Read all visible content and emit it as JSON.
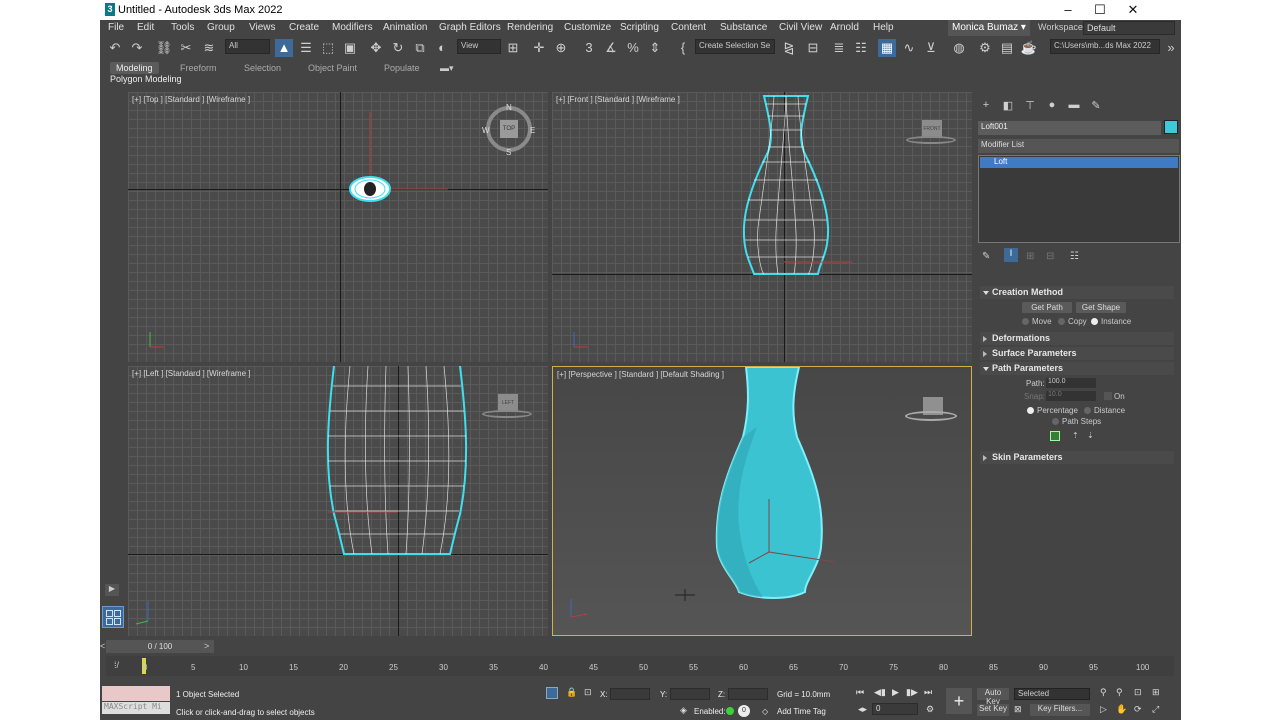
{
  "window": {
    "title": "Untitled - Autodesk 3ds Max 2022",
    "minimize": "–",
    "maximize": "☐",
    "close": "✕"
  },
  "menu": [
    "File",
    "Edit",
    "Tools",
    "Group",
    "Views",
    "Create",
    "Modifiers",
    "Animation",
    "Graph Editors",
    "Rendering",
    "Customize",
    "Scripting",
    "Content",
    "Substance",
    "Civil View",
    "Arnold",
    "Help"
  ],
  "user": {
    "name": "Monica Bumaz ▾",
    "workspaces_label": "Workspaces:",
    "workspace": "Default"
  },
  "toolbar": {
    "filter": "All",
    "refcoord": "View",
    "selection_set": "Create Selection Se",
    "project_path": "C:\\Users\\mb...ds Max 2022"
  },
  "ribbon": {
    "tabs": [
      "Modeling",
      "Freeform",
      "Selection",
      "Object Paint",
      "Populate"
    ],
    "sub": "Polygon Modeling"
  },
  "viewports": {
    "top": "[+] [Top ] [Standard ] [Wireframe ]",
    "front": "[+] [Front ] [Standard ] [Wireframe ]",
    "left": "[+] [Left ] [Standard ] [Wireframe ]",
    "perspective": "[+] [Perspective ] [Standard ] [Default Shading ]"
  },
  "viewcube": {
    "top_label": "TOP",
    "front_label": "FRONT",
    "left_label": "LEFT",
    "compass": [
      "N",
      "S",
      "E",
      "W"
    ]
  },
  "command_panel": {
    "object_name": "Loft001",
    "modifier_list": "Modifier List",
    "stack_item": "Loft",
    "object_color": "#3ec8d8",
    "creation_method": {
      "title": "Creation Method",
      "get_path": "Get Path",
      "get_shape": "Get Shape",
      "move": "Move",
      "copy": "Copy",
      "instance": "Instance"
    },
    "deformations": "Deformations",
    "surface_parameters": "Surface Parameters",
    "path_parameters": {
      "title": "Path Parameters",
      "path_label": "Path:",
      "path_value": "100.0",
      "snap_label": "Snap:",
      "snap_value": "10.0",
      "on": "On",
      "percentage": "Percentage",
      "distance": "Distance",
      "path_steps": "Path Steps"
    },
    "skin_parameters": "Skin Parameters"
  },
  "timeline": {
    "frame": "0 / 100",
    "ticks": [
      "0",
      "5",
      "10",
      "15",
      "20",
      "25",
      "30",
      "35",
      "40",
      "45",
      "50",
      "55",
      "60",
      "65",
      "70",
      "75",
      "80",
      "85",
      "90",
      "95",
      "100"
    ]
  },
  "status": {
    "selected": "1 Object Selected",
    "prompt": "Click or click-and-drag to select objects",
    "maxscript": "MAXScript Mi",
    "x_label": "X:",
    "y_label": "Y:",
    "z_label": "Z:",
    "grid": "Grid = 10.0mm",
    "enabled_label": "Enabled:",
    "add_time_tag": "Add Time Tag",
    "auto_key": "Auto Key",
    "set_key": "Set Key",
    "selected_dropdown": "Selected",
    "key_filters": "Key Filters...",
    "frame_value": "0"
  }
}
